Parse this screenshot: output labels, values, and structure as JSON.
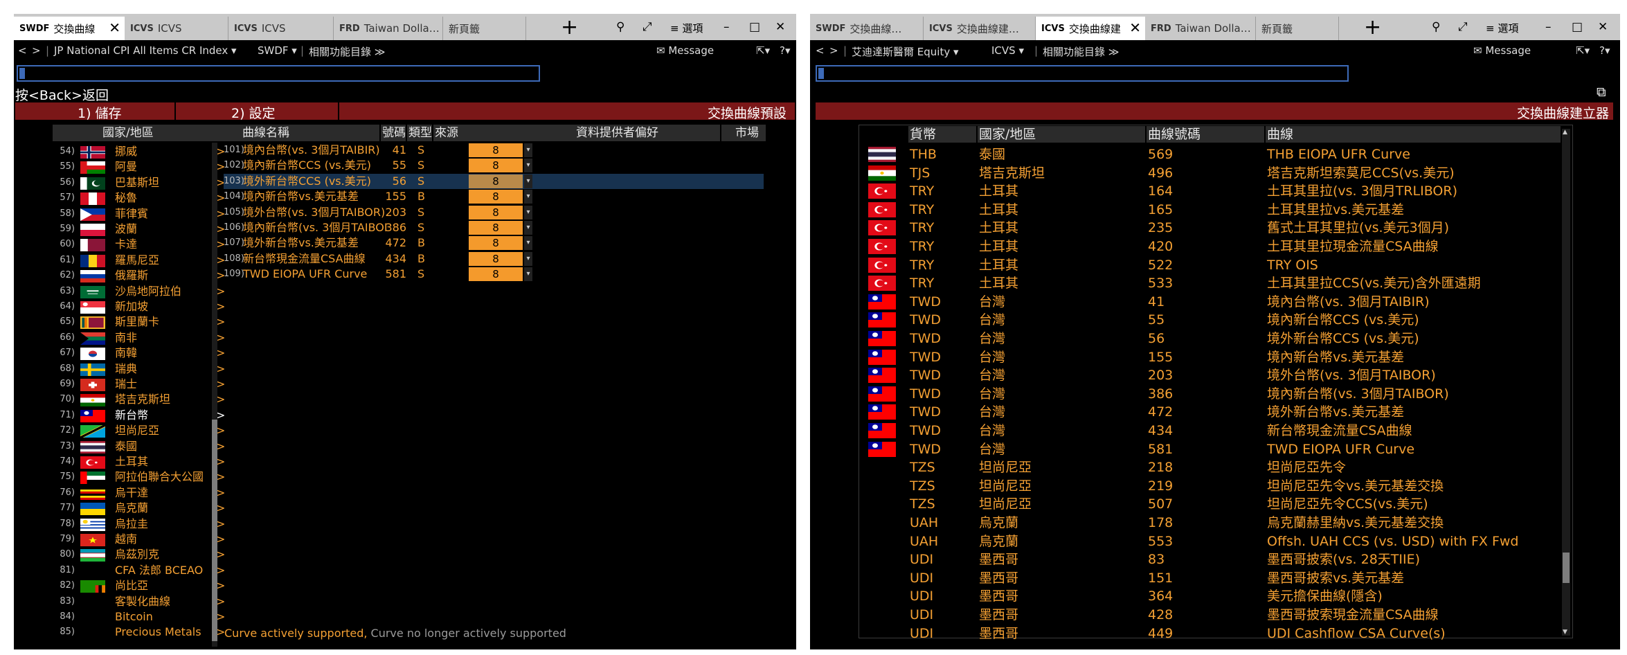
{
  "left": {
    "tabs": [
      {
        "code": "SWDF",
        "label": "交換曲線",
        "active": true
      },
      {
        "code": "ICVS",
        "label": "ICVS",
        "active": false
      },
      {
        "code": "ICVS",
        "label": "ICVS",
        "active": false
      },
      {
        "code": "FRD",
        "label": "Taiwan Dolla…",
        "active": false
      },
      {
        "code": "",
        "label": "新頁籤",
        "active": false
      }
    ],
    "toolbar": {
      "options_label": "選項"
    },
    "nav": {
      "security": "JP National CPI All Items CR Index",
      "function": "SWDF",
      "related": "相關功能目錄",
      "message": "Message"
    },
    "back_hint": "按<Back>返回",
    "menu": {
      "save": "1) 儲存",
      "settings": "2) 設定",
      "title": "交換曲線預設"
    },
    "country_header": "國家/地區",
    "countries": [
      {
        "num": "54)",
        "name": "挪威",
        "flag": "no"
      },
      {
        "num": "55)",
        "name": "阿曼",
        "flag": "om"
      },
      {
        "num": "56)",
        "name": "巴基斯坦",
        "flag": "pk"
      },
      {
        "num": "57)",
        "name": "秘魯",
        "flag": "pe"
      },
      {
        "num": "58)",
        "name": "菲律賓",
        "flag": "ph"
      },
      {
        "num": "59)",
        "name": "波蘭",
        "flag": "pl"
      },
      {
        "num": "60)",
        "name": "卡達",
        "flag": "qa"
      },
      {
        "num": "61)",
        "name": "羅馬尼亞",
        "flag": "ro"
      },
      {
        "num": "62)",
        "name": "俄羅斯",
        "flag": "ru"
      },
      {
        "num": "63)",
        "name": "沙烏地阿拉伯",
        "flag": "sa"
      },
      {
        "num": "64)",
        "name": "新加坡",
        "flag": "sg"
      },
      {
        "num": "65)",
        "name": "斯里蘭卡",
        "flag": "lk"
      },
      {
        "num": "66)",
        "name": "南非",
        "flag": "za"
      },
      {
        "num": "67)",
        "name": "南韓",
        "flag": "kr"
      },
      {
        "num": "68)",
        "name": "瑞典",
        "flag": "se"
      },
      {
        "num": "69)",
        "name": "瑞士",
        "flag": "ch"
      },
      {
        "num": "70)",
        "name": "塔吉克斯坦",
        "flag": "tj"
      },
      {
        "num": "71)",
        "name": "新台幣",
        "flag": "tw",
        "selected": true
      },
      {
        "num": "72)",
        "name": "坦尚尼亞",
        "flag": "tz"
      },
      {
        "num": "73)",
        "name": "泰國",
        "flag": "th"
      },
      {
        "num": "74)",
        "name": "土耳其",
        "flag": "tr"
      },
      {
        "num": "75)",
        "name": "阿拉伯聯合大公國",
        "flag": "ae"
      },
      {
        "num": "76)",
        "name": "烏干達",
        "flag": "ug"
      },
      {
        "num": "77)",
        "name": "烏克蘭",
        "flag": "ua"
      },
      {
        "num": "78)",
        "name": "烏拉圭",
        "flag": "uy"
      },
      {
        "num": "79)",
        "name": "越南",
        "flag": "vn"
      },
      {
        "num": "80)",
        "name": "烏茲別克",
        "flag": "uz"
      },
      {
        "num": "81)",
        "name": "CFA 法郎 BCEAO",
        "flag": ""
      },
      {
        "num": "82)",
        "name": "尚比亞",
        "flag": "zm"
      },
      {
        "num": "83)",
        "name": "客製化曲線",
        "flag": ""
      },
      {
        "num": "84)",
        "name": "Bitcoin",
        "flag": ""
      },
      {
        "num": "85)",
        "name": "Precious Metals",
        "flag": ""
      }
    ],
    "curve_headers": {
      "name": "曲線名稱",
      "num": "號碼",
      "type": "類型",
      "source": "來源",
      "pref": "資料提供者偏好",
      "market": "市場"
    },
    "curves": [
      {
        "idx": "101)",
        "name": "境內台幣(vs. 3個月TAIBIR)",
        "num": "41",
        "type": "S",
        "src": "8"
      },
      {
        "idx": "102)",
        "name": "境內新台幣CCS (vs.美元)",
        "num": "55",
        "type": "S",
        "src": "8"
      },
      {
        "idx": "103)",
        "name": "境外新台幣CCS (vs.美元)",
        "num": "56",
        "type": "S",
        "src": "8",
        "selected": true
      },
      {
        "idx": "104)",
        "name": "境內新台幣vs.美元基差",
        "num": "155",
        "type": "B",
        "src": "8"
      },
      {
        "idx": "105)",
        "name": "境外台幣(vs. 3個月TAIBOR)",
        "num": "203",
        "type": "S",
        "src": "8"
      },
      {
        "idx": "106)",
        "name": "境內新台幣(vs. 3個月TAIBOI",
        "num": "386",
        "type": "S",
        "src": "8"
      },
      {
        "idx": "107)",
        "name": "境外新台幣vs.美元基差",
        "num": "472",
        "type": "B",
        "src": "8"
      },
      {
        "idx": "108)",
        "name": "新台幣現金流量CSA曲線",
        "num": "434",
        "type": "B",
        "src": "8"
      },
      {
        "idx": "109)",
        "name": "TWD EIOPA UFR Curve",
        "num": "581",
        "type": "S",
        "src": "8"
      }
    ],
    "footer_supported": "Curve actively supported,",
    "footer_unsupported": "Curve no longer actively supported"
  },
  "right": {
    "tabs": [
      {
        "code": "SWDF",
        "label": "交換曲線…",
        "active": false
      },
      {
        "code": "ICVS",
        "label": "交換曲線建…",
        "active": false
      },
      {
        "code": "ICVS",
        "label": "交換曲線建",
        "active": true
      },
      {
        "code": "FRD",
        "label": "Taiwan Dolla…",
        "active": false
      },
      {
        "code": "",
        "label": "新頁籤",
        "active": false
      }
    ],
    "toolbar": {
      "options_label": "選項"
    },
    "nav": {
      "security": "艾迪達斯醫爾 Equity",
      "function": "ICVS",
      "related": "相關功能目錄",
      "message": "Message"
    },
    "title": "交換曲線建立器",
    "headers": {
      "ccy": "貨幣",
      "country": "國家/地區",
      "num": "曲線號碼",
      "curve": "曲線"
    },
    "rows": [
      {
        "ccy": "THB",
        "country": "泰國",
        "num": "569",
        "curve": "THB EIOPA UFR Curve",
        "flag": "th"
      },
      {
        "ccy": "TJS",
        "country": "塔吉克斯坦",
        "num": "496",
        "curve": "塔吉克斯坦索莫尼CCS(vs.美元)",
        "flag": "tj"
      },
      {
        "ccy": "TRY",
        "country": "土耳其",
        "num": "164",
        "curve": "土耳其里拉(vs. 3個月TRLIBOR)",
        "flag": "tr"
      },
      {
        "ccy": "TRY",
        "country": "土耳其",
        "num": "165",
        "curve": "土耳其里拉vs.美元基差",
        "flag": "tr"
      },
      {
        "ccy": "TRY",
        "country": "土耳其",
        "num": "235",
        "curve": "舊式土耳其里拉(vs.美元3個月)",
        "flag": "tr"
      },
      {
        "ccy": "TRY",
        "country": "土耳其",
        "num": "420",
        "curve": "土耳其里拉現金流量CSA曲線",
        "flag": "tr"
      },
      {
        "ccy": "TRY",
        "country": "土耳其",
        "num": "522",
        "curve": "TRY OIS",
        "flag": "tr"
      },
      {
        "ccy": "TRY",
        "country": "土耳其",
        "num": "533",
        "curve": "土耳其里拉CCS(vs.美元)含外匯遠期",
        "flag": "tr"
      },
      {
        "ccy": "TWD",
        "country": "台灣",
        "num": "41",
        "curve": "境內台幣(vs. 3個月TAIBIR)",
        "flag": "tw"
      },
      {
        "ccy": "TWD",
        "country": "台灣",
        "num": "55",
        "curve": "境內新台幣CCS (vs.美元)",
        "flag": "tw"
      },
      {
        "ccy": "TWD",
        "country": "台灣",
        "num": "56",
        "curve": "境外新台幣CCS (vs.美元)",
        "flag": "tw"
      },
      {
        "ccy": "TWD",
        "country": "台灣",
        "num": "155",
        "curve": "境內新台幣vs.美元基差",
        "flag": "tw"
      },
      {
        "ccy": "TWD",
        "country": "台灣",
        "num": "203",
        "curve": "境外台幣(vs. 3個月TAIBOR)",
        "flag": "tw"
      },
      {
        "ccy": "TWD",
        "country": "台灣",
        "num": "386",
        "curve": "境內新台幣(vs. 3個月TAIBOR)",
        "flag": "tw"
      },
      {
        "ccy": "TWD",
        "country": "台灣",
        "num": "472",
        "curve": "境外新台幣vs.美元基差",
        "flag": "tw"
      },
      {
        "ccy": "TWD",
        "country": "台灣",
        "num": "434",
        "curve": "新台幣現金流量CSA曲線",
        "flag": "tw"
      },
      {
        "ccy": "TWD",
        "country": "台灣",
        "num": "581",
        "curve": "TWD EIOPA UFR Curve",
        "flag": "tw"
      },
      {
        "ccy": "TZS",
        "country": "坦尚尼亞",
        "num": "218",
        "curve": "坦尚尼亞先令",
        "flag": ""
      },
      {
        "ccy": "TZS",
        "country": "坦尚尼亞",
        "num": "219",
        "curve": "坦尚尼亞先令vs.美元基差交換",
        "flag": ""
      },
      {
        "ccy": "TZS",
        "country": "坦尚尼亞",
        "num": "507",
        "curve": "坦尚尼亞先令CCS(vs.美元)",
        "flag": ""
      },
      {
        "ccy": "UAH",
        "country": "烏克蘭",
        "num": "178",
        "curve": "烏克蘭赫里納vs.美元基差交換",
        "flag": ""
      },
      {
        "ccy": "UAH",
        "country": "烏克蘭",
        "num": "553",
        "curve": "Offsh. UAH CCS (vs. USD) with FX Fwd",
        "flag": ""
      },
      {
        "ccy": "UDI",
        "country": "墨西哥",
        "num": "83",
        "curve": "墨西哥披索(vs. 28天TIIE)",
        "flag": ""
      },
      {
        "ccy": "UDI",
        "country": "墨西哥",
        "num": "151",
        "curve": "墨西哥披索vs.美元基差",
        "flag": ""
      },
      {
        "ccy": "UDI",
        "country": "墨西哥",
        "num": "364",
        "curve": "美元擔保曲線(隱含)",
        "flag": ""
      },
      {
        "ccy": "UDI",
        "country": "墨西哥",
        "num": "428",
        "curve": "墨西哥披索現金流量CSA曲線",
        "flag": ""
      },
      {
        "ccy": "UDI",
        "country": "墨西哥",
        "num": "449",
        "curve": "UDI Cashflow CSA Curve(s)",
        "flag": ""
      }
    ]
  },
  "colors": {
    "accent_orange": "#f4a033",
    "red_bar": "#7b1718",
    "source_box": "#f49a2c",
    "selection": "#17324f",
    "command_border": "#3d6ab8"
  }
}
